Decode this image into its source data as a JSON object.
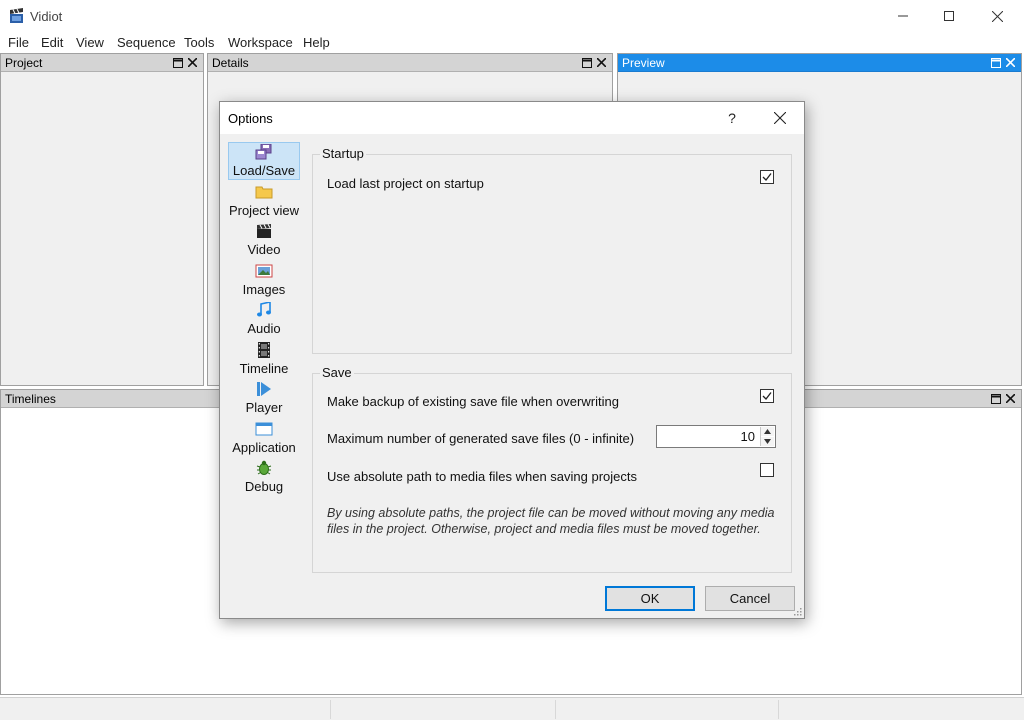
{
  "window": {
    "title": "Vidiot"
  },
  "menubar": [
    "File",
    "Edit",
    "View",
    "Sequence",
    "Tools",
    "Workspace",
    "Help"
  ],
  "panes": {
    "project": "Project",
    "details": "Details",
    "preview": "Preview",
    "timelines": "Timelines"
  },
  "dialog": {
    "title": "Options",
    "help_label": "?",
    "categories": [
      {
        "label": "Load/Save",
        "icon": "disks-icon",
        "selected": true
      },
      {
        "label": "Project view",
        "icon": "folder-icon"
      },
      {
        "label": "Video",
        "icon": "clapper-icon"
      },
      {
        "label": "Images",
        "icon": "picture-icon"
      },
      {
        "label": "Audio",
        "icon": "music-note-icon"
      },
      {
        "label": "Timeline",
        "icon": "film-strip-icon"
      },
      {
        "label": "Player",
        "icon": "play-icon"
      },
      {
        "label": "Application",
        "icon": "window-icon"
      },
      {
        "label": "Debug",
        "icon": "bug-icon"
      }
    ],
    "startup": {
      "title": "Startup",
      "load_last_label": "Load last project on startup",
      "load_last_checked": true
    },
    "save": {
      "title": "Save",
      "backup_label": "Make backup of existing save file when overwriting",
      "backup_checked": true,
      "max_files_label": "Maximum number of generated save files (0 - infinite)",
      "max_files_value": "10",
      "absolute_label": "Use absolute path to media files when saving projects",
      "absolute_checked": false,
      "note": "By using absolute paths, the project file can be moved without moving any media files in the project. Otherwise, project and media files must be moved together."
    },
    "ok_label": "OK",
    "cancel_label": "Cancel"
  },
  "colors": {
    "active_pane_header": "#1c8ce8",
    "selection": "#cce4f7",
    "default_button_border": "#0078d7"
  }
}
